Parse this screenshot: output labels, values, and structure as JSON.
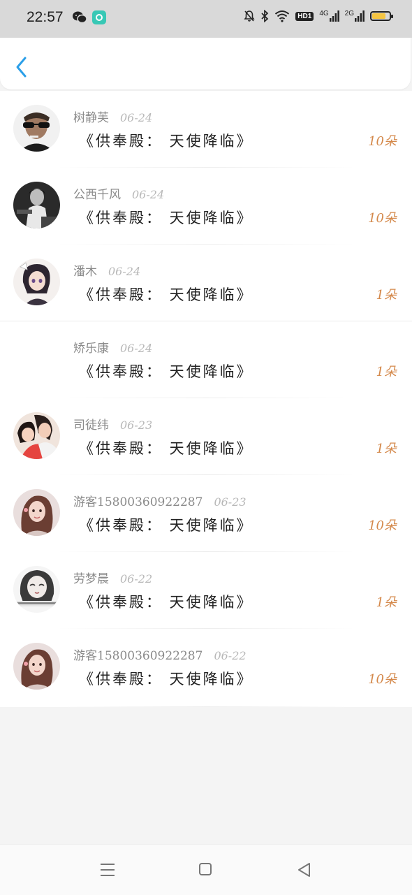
{
  "status_bar": {
    "time": "22:57",
    "icons": [
      "wechat-icon",
      "app-icon",
      "mute-bell-icon",
      "bluetooth-icon",
      "wifi-icon",
      "hd-icon",
      "signal-4g-icon",
      "signal-2g-icon",
      "battery-icon"
    ],
    "hd_label": "HD1",
    "net1_label": "4G",
    "net2_label": "2G"
  },
  "header": {
    "back_icon": "chevron-left-icon",
    "accent": "#2b9fe8"
  },
  "items": [
    {
      "name": "树静芙",
      "date": "06-24",
      "title": "《供奉殿： 天使降临》",
      "amount": "10朵",
      "avatar": "avatar-man-sunglasses"
    },
    {
      "name": "公西千风",
      "date": "06-24",
      "title": "《供奉殿： 天使降临》",
      "amount": "10朵",
      "avatar": "avatar-bw-person"
    },
    {
      "name": "潘木",
      "date": "06-24",
      "title": "《供奉殿： 天使降临》",
      "amount": "1朵",
      "avatar": "avatar-anime-girl"
    },
    {
      "name": "矫乐康",
      "date": "06-24",
      "title": "《供奉殿： 天使降临》",
      "amount": "1朵",
      "avatar": "avatar-empty"
    },
    {
      "name": "司徒纬",
      "date": "06-23",
      "title": "《供奉殿： 天使降临》",
      "amount": "1朵",
      "avatar": "avatar-illustrated-couple"
    },
    {
      "name": "游客15800360922287",
      "date": "06-23",
      "title": "《供奉殿： 天使降临》",
      "amount": "10朵",
      "avatar": "avatar-woman-portrait"
    },
    {
      "name": "劳梦晨",
      "date": "06-22",
      "title": "《供奉殿： 天使降临》",
      "amount": "1朵",
      "avatar": "avatar-sketch-girl"
    },
    {
      "name": "游客15800360922287",
      "date": "06-22",
      "title": "《供奉殿： 天使降临》",
      "amount": "10朵",
      "avatar": "avatar-woman-portrait"
    }
  ],
  "colors": {
    "amount": "#d4884a",
    "name": "#8a8a8a",
    "date": "#b8b8b8",
    "title": "#222222"
  },
  "bottom_nav": {
    "icons": [
      "menu-icon",
      "home-square-icon",
      "back-triangle-icon"
    ]
  }
}
